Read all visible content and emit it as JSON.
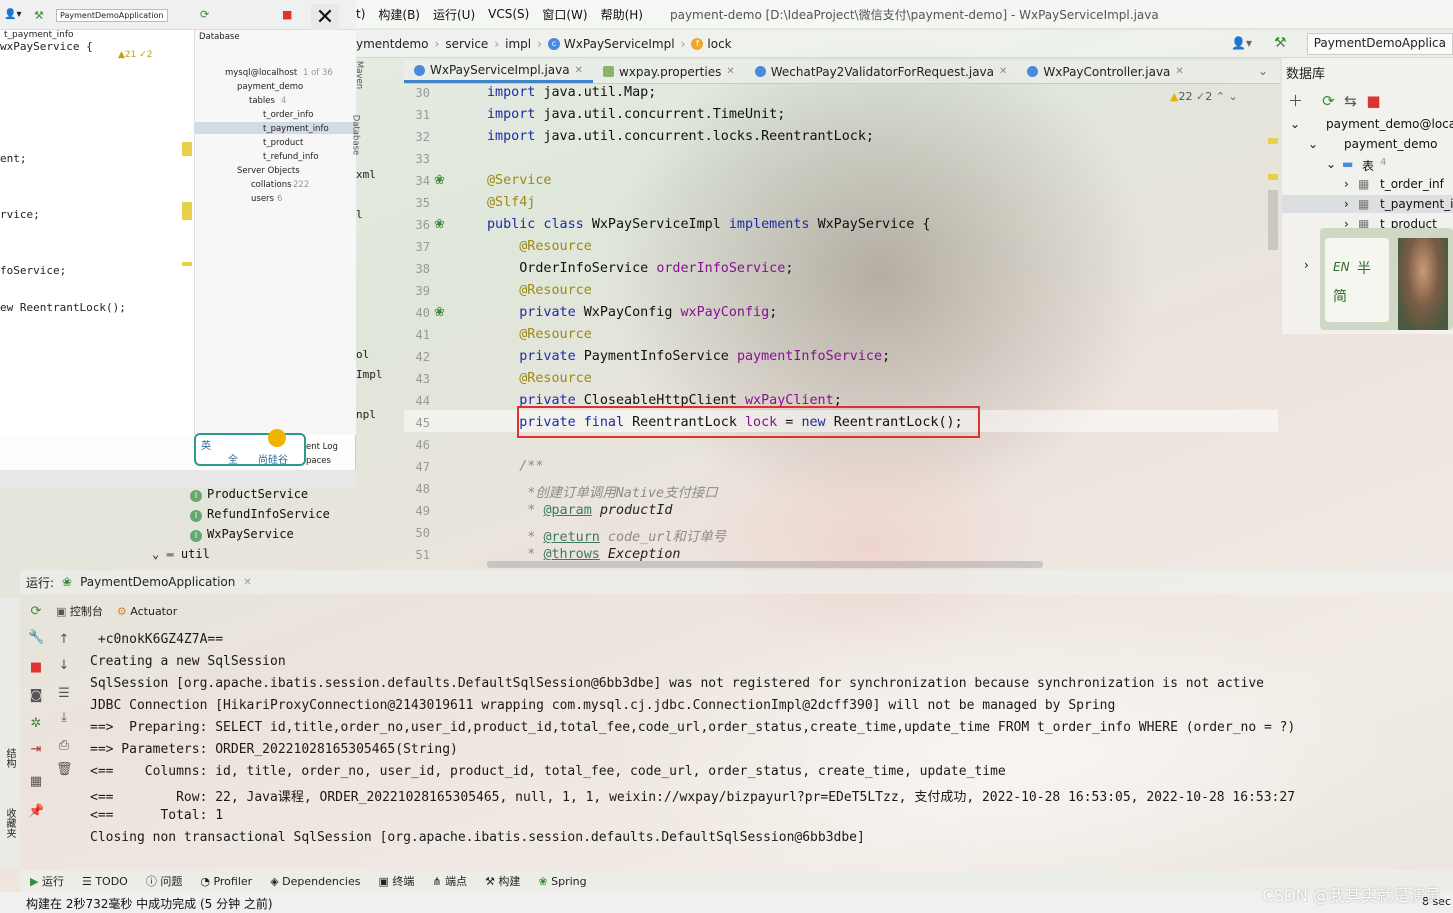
{
  "menubar": {
    "items": [
      "构建(B)",
      "运行(U)",
      "VCS(S)",
      "窗口(W)",
      "帮助(H)"
    ],
    "partial_prefix": "t)",
    "title": "payment-demo [D:\\IdeaProject\\微信支付\\payment-demo] - WxPayServiceImpl.java"
  },
  "navbar": {
    "crumbs": [
      "ymentdemo",
      "service",
      "impl",
      "WxPayServiceImpl",
      "lock"
    ],
    "run_config": "PaymentDemoApplica"
  },
  "tabs": [
    {
      "label": "WxPayServiceImpl.java",
      "active": true
    },
    {
      "label": "wxpay.properties",
      "active": false
    },
    {
      "label": "WechatPay2ValidatorForRequest.java",
      "active": false
    },
    {
      "label": "WxPayController.java",
      "active": false
    }
  ],
  "editor": {
    "warnings": "22",
    "weak_warnings": "2",
    "line_numbers": [
      "30",
      "31",
      "32",
      "33",
      "34",
      "35",
      "36",
      "37",
      "38",
      "39",
      "40",
      "41",
      "42",
      "43",
      "44",
      "45",
      "46",
      "47",
      "48",
      "49",
      "50",
      "51"
    ],
    "lines": [
      {
        "kw": "import ",
        "rest": "java.util.Map;"
      },
      {
        "kw": "import ",
        "rest": "java.util.concurrent.TimeUnit;"
      },
      {
        "kw": "import ",
        "rest": "java.util.concurrent.locks.ReentrantLock;"
      },
      {
        "text": ""
      },
      {
        "an": "@Service"
      },
      {
        "an": "@Slf4j"
      },
      {
        "kw": "public class ",
        "rest": "WxPayServiceImpl ",
        "kw2": "implements ",
        "rest2": "WxPayService {"
      },
      {
        "an": "    @Resource"
      },
      {
        "rest": "    OrderInfoService ",
        "fd": "orderInfoService",
        "end": ";"
      },
      {
        "an": "    @Resource"
      },
      {
        "kw": "    private ",
        "rest": "WxPayConfig ",
        "fd": "wxPayConfig",
        "end": ";"
      },
      {
        "an": "    @Resource"
      },
      {
        "kw": "    private ",
        "rest": "PaymentInfoService ",
        "fd": "paymentInfoService",
        "end": ";"
      },
      {
        "an": "    @Resource"
      },
      {
        "kw": "    private ",
        "rest": "CloseableHttpClient ",
        "fd": "wxPayClient",
        "end": ";"
      },
      {
        "kw": "    private final ",
        "rest": "ReentrantLock ",
        "fd": "lock",
        "end": " = ",
        "kw2": "new ",
        "rest2": "ReentrantLock();"
      },
      {
        "text": ""
      },
      {
        "cm": "    /**"
      },
      {
        "cm": "     *创建订单调用Native支付接口"
      },
      {
        "cm": "     * ",
        "tg": "@param",
        "ul": " productId"
      },
      {
        "cm": "     * ",
        "tg": "@return",
        "cm2": " code_url和订单号"
      },
      {
        "cm": "     * ",
        "tg": "@throws",
        "ul": " Exception"
      }
    ]
  },
  "db_panel": {
    "title": "数据库",
    "items": [
      "payment_demo@local",
      "payment_demo",
      "表",
      "4",
      "t_order_inf",
      "t_payment_i",
      "t_product"
    ]
  },
  "left_window": {
    "file_tab": "t_payment_info",
    "run_config": "PaymentDemoApplication",
    "code_fragments": [
      "wxPayService {",
      "ent;",
      "rvice;",
      "foService;",
      "ew ReentrantLock();"
    ],
    "warn_count": "21",
    "weak_count": "2",
    "db_label": "Database",
    "db_tree": [
      "mysql@localhost",
      "1 of 36",
      "payment_demo",
      "tables",
      "4",
      "t_order_info",
      "t_payment_info",
      "t_product",
      "t_refund_info",
      "Server Objects",
      "collations",
      "222",
      "users",
      "6"
    ],
    "side_fragments": [
      "xml",
      "l",
      "ol",
      "Impl",
      "npl"
    ],
    "side_labels": [
      "Maven",
      "Database"
    ],
    "event_log": [
      "ent Log",
      "paces"
    ]
  },
  "ime": {
    "lang": "英",
    "full": "全",
    "brand": "尚硅谷"
  },
  "project_tree": [
    "ProductService",
    "RefundInfoService",
    "WxPayService",
    "util"
  ],
  "run": {
    "label": "运行:",
    "config": "PaymentDemoApplication",
    "tabs": [
      "控制台",
      "Actuator"
    ],
    "console": [
      " +c0nokK6GZ4Z7A==",
      "Creating a new SqlSession",
      "SqlSession [org.apache.ibatis.session.defaults.DefaultSqlSession@6bb3dbe] was not registered for synchronization because synchronization is not active",
      "JDBC Connection [HikariProxyConnection@2143019611 wrapping com.mysql.cj.jdbc.ConnectionImpl@2dcff390] will not be managed by Spring",
      "==>  Preparing: SELECT id,title,order_no,user_id,product_id,total_fee,code_url,order_status,create_time,update_time FROM t_order_info WHERE (order_no = ?)",
      "==> Parameters: ORDER_20221028165305465(String)",
      "<==    Columns: id, title, order_no, user_id, product_id, total_fee, code_url, order_status, create_time, update_time",
      "<==        Row: 22, Java课程, ORDER_20221028165305465, null, 1, 1, weixin://wxpay/bizpayurl?pr=EDeT5LTzz, 支付成功, 2022-10-28 16:53:05, 2022-10-28 16:53:27",
      "<==      Total: 1",
      "Closing non transactional SqlSession [org.apache.ibatis.session.defaults.DefaultSqlSession@6bb3dbe]"
    ]
  },
  "left_bar_labels": [
    "结构",
    "收藏夹"
  ],
  "toolwindows": [
    "运行",
    "TODO",
    "问题",
    "Profiler",
    "Dependencies",
    "终端",
    "端点",
    "构建",
    "Spring"
  ],
  "status": "构建在 2秒732毫秒 中成功完成 (5 分钟 之前)",
  "status_right": "8 sec",
  "watermark": "CSDN @我其实就是演员",
  "cam_text": {
    "en": "EN",
    "ch": "半",
    "ch2": "简"
  }
}
